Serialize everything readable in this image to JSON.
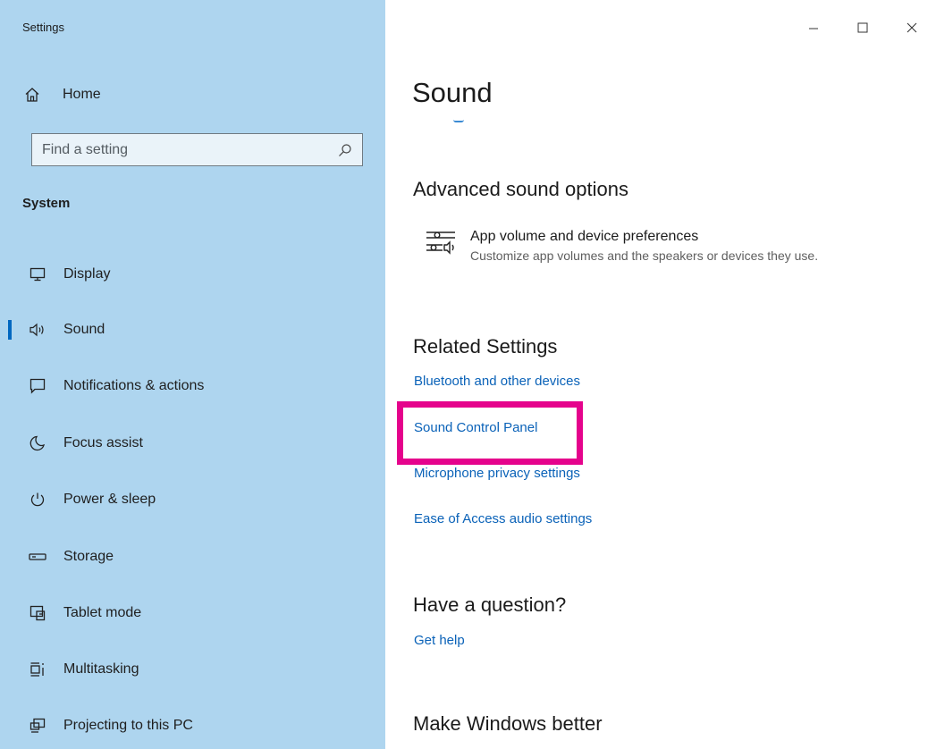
{
  "window": {
    "title": "Settings"
  },
  "sidebar": {
    "home_label": "Home",
    "search_placeholder": "Find a setting",
    "section_heading": "System",
    "items": [
      {
        "label": "Display",
        "icon": "display-icon",
        "selected": false
      },
      {
        "label": "Sound",
        "icon": "speaker-icon",
        "selected": true
      },
      {
        "label": "Notifications & actions",
        "icon": "notifications-icon",
        "selected": false
      },
      {
        "label": "Focus assist",
        "icon": "moon-icon",
        "selected": false
      },
      {
        "label": "Power & sleep",
        "icon": "power-icon",
        "selected": false
      },
      {
        "label": "Storage",
        "icon": "storage-icon",
        "selected": false
      },
      {
        "label": "Tablet mode",
        "icon": "tablet-mode-icon",
        "selected": false
      },
      {
        "label": "Multitasking",
        "icon": "multitasking-icon",
        "selected": false
      },
      {
        "label": "Projecting to this PC",
        "icon": "projecting-icon",
        "selected": false
      }
    ]
  },
  "main": {
    "title": "Sound",
    "advanced": {
      "heading": "Advanced sound options",
      "item_title": "App volume and device preferences",
      "item_desc": "Customize app volumes and the speakers or devices they use."
    },
    "related": {
      "heading": "Related Settings",
      "links": [
        "Bluetooth and other devices",
        "Sound Control Panel",
        "Microphone privacy settings",
        "Ease of Access audio settings"
      ]
    },
    "question": {
      "heading": "Have a question?",
      "link": "Get help"
    },
    "better": {
      "heading": "Make Windows better"
    }
  },
  "colors": {
    "sidebar_bg": "#aed5ef",
    "link": "#0a62b8",
    "accent": "#0067c0",
    "highlight": "#e5038c"
  }
}
